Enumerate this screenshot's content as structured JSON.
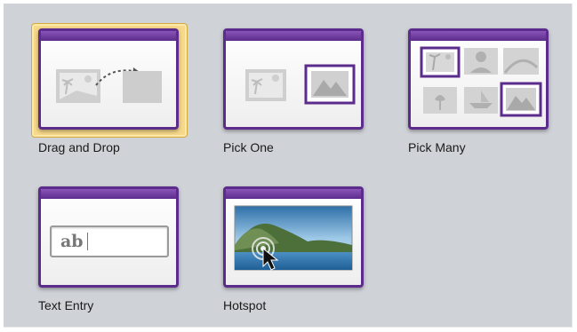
{
  "interaction_types": [
    {
      "id": "drag-and-drop",
      "label": "Drag and Drop",
      "selected": true,
      "icon": "drag-and-drop-thumbnail"
    },
    {
      "id": "pick-one",
      "label": "Pick One",
      "selected": false,
      "icon": "pick-one-thumbnail"
    },
    {
      "id": "pick-many",
      "label": "Pick Many",
      "selected": false,
      "icon": "pick-many-thumbnail"
    },
    {
      "id": "text-entry",
      "label": "Text Entry",
      "selected": false,
      "icon": "text-entry-thumbnail",
      "sample_text": "ab"
    },
    {
      "id": "hotspot",
      "label": "Hotspot",
      "selected": false,
      "icon": "hotspot-thumbnail"
    }
  ],
  "colors": {
    "panel_background": "#cfd2d7",
    "window_frame": "#5b2c8c",
    "selection_highlight": "#f7d98a"
  }
}
